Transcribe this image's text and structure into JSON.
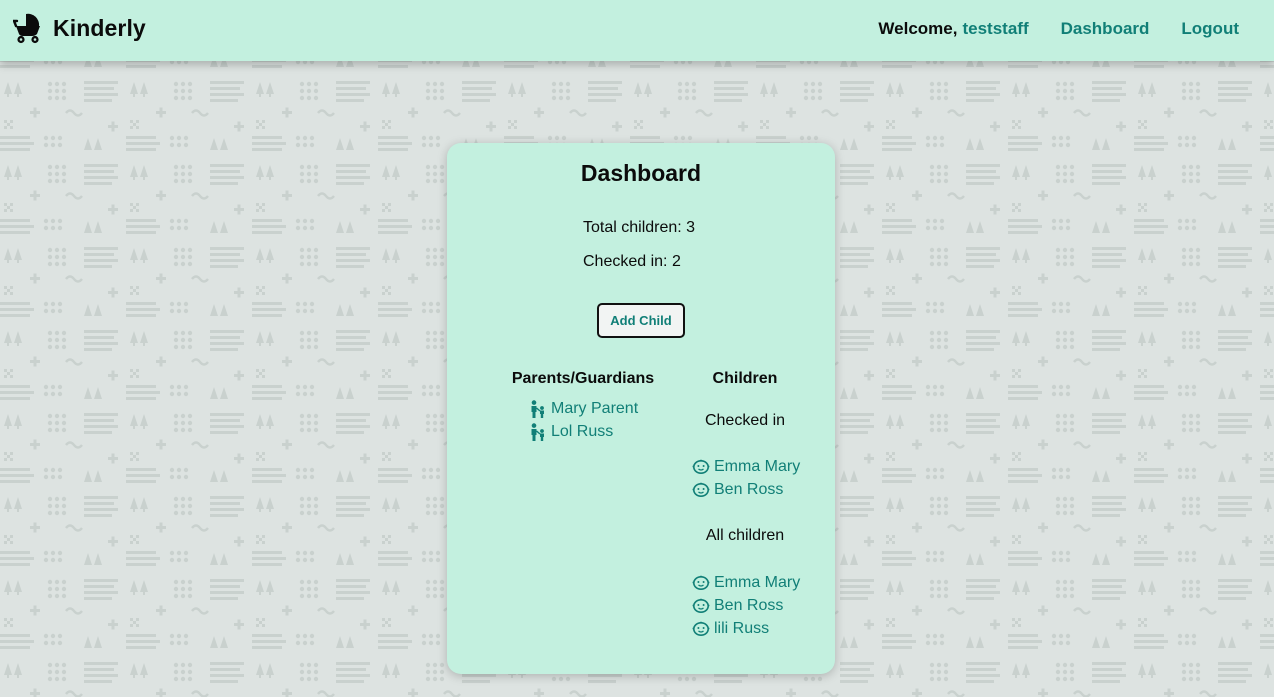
{
  "app": {
    "brand_name": "Kinderly",
    "brand_icon": "stroller-icon"
  },
  "nav": {
    "welcome_label": "Welcome,",
    "username": "teststaff",
    "dashboard_label": "Dashboard",
    "logout_label": "Logout"
  },
  "dashboard": {
    "title": "Dashboard",
    "total_children": "Total children: 3",
    "checked_in": "Checked in: 2",
    "add_child_label": "Add Child",
    "parents_heading": "Parents/Guardians",
    "children_heading": "Children",
    "checked_in_heading": "Checked in",
    "all_children_heading": "All children",
    "parents": [
      {
        "name": "Mary Parent",
        "icon": "parent-child-icon"
      },
      {
        "name": "Lol Russ",
        "icon": "parent-child-icon"
      }
    ],
    "checked_in_children": [
      {
        "name": "Emma Mary",
        "icon": "baby-face-icon"
      },
      {
        "name": "Ben Ross",
        "icon": "baby-face-icon"
      }
    ],
    "all_children": [
      {
        "name": "Emma Mary",
        "icon": "baby-face-icon"
      },
      {
        "name": "Ben Ross",
        "icon": "baby-face-icon"
      },
      {
        "name": "lili Russ",
        "icon": "baby-face-icon"
      }
    ]
  },
  "colors": {
    "accent": "#117f77",
    "panel": "#c3f0df",
    "background": "#dde3e1"
  }
}
